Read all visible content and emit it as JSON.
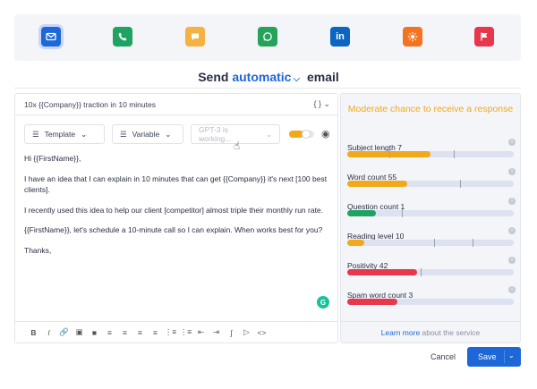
{
  "channels": [
    {
      "name": "email",
      "icon": "mail-icon",
      "color": "#1d67d8",
      "active": true
    },
    {
      "name": "phone",
      "icon": "phone-icon",
      "color": "#1fa363",
      "active": false
    },
    {
      "name": "chat",
      "icon": "chat-icon",
      "color": "#f5b142",
      "active": false
    },
    {
      "name": "whatsapp",
      "icon": "whatsapp-icon",
      "color": "#25a35a",
      "active": false
    },
    {
      "name": "linkedin",
      "icon": "linkedin-icon",
      "color": "#0a66c2",
      "active": false
    },
    {
      "name": "hubspot",
      "icon": "sun-icon",
      "color": "#f47321",
      "active": false
    },
    {
      "name": "flag",
      "icon": "flag-icon",
      "color": "#e8364d",
      "active": false
    }
  ],
  "header": {
    "send_prefix": "Send",
    "send_accent": "automatic",
    "send_suffix": "email"
  },
  "editor": {
    "subject": "10x {{Company}} traction in 10 minutes",
    "braces": "{ }",
    "template_label": "Template",
    "variable_label": "Variable",
    "gpt_label": "GPT-3 is working...",
    "body": [
      "Hi {{FirstName}},",
      "I have an idea that I can explain in 10 minutes that can get {{Company}} it's next [100 best clients].",
      "I recently used this idea to help our client [competitor] almost triple their monthly run rate.",
      "{{FirstName}}, let's schedule a 10-minute call so I can explain. When works best for you?",
      "Thanks,"
    ]
  },
  "formatting": [
    "B",
    "I",
    "link",
    "image",
    "image-fill",
    "align-left",
    "align-center",
    "align-right",
    "align-justify",
    "list-bullet",
    "list-number",
    "indent-less",
    "indent-more",
    "attach",
    "video",
    "code"
  ],
  "scores": {
    "heading": "Moderate chance to receive a response",
    "metrics": [
      {
        "label": "Subject length 7",
        "fill": 0.5,
        "color": "#f1a91b",
        "markers": [
          0.25,
          0.64
        ]
      },
      {
        "label": "Word count 55",
        "fill": 0.36,
        "color": "#f1a91b",
        "markers": [
          0.68
        ]
      },
      {
        "label": "Question count 1",
        "fill": 0.17,
        "color": "#1fa363",
        "markers": [
          0.33
        ]
      },
      {
        "label": "Reading level 10",
        "fill": 0.1,
        "color": "#f1a91b",
        "markers": [
          0.52,
          0.75
        ]
      },
      {
        "label": "Positivity 42",
        "fill": 0.42,
        "color": "#e8364d",
        "markers": [
          0.44
        ]
      },
      {
        "label": "Spam word count 3",
        "fill": 0.3,
        "color": "#e8364d",
        "markers": []
      }
    ],
    "learn_link": "Learn more",
    "learn_rest": " about the service"
  },
  "actions": {
    "cancel": "Cancel",
    "save": "Save"
  }
}
